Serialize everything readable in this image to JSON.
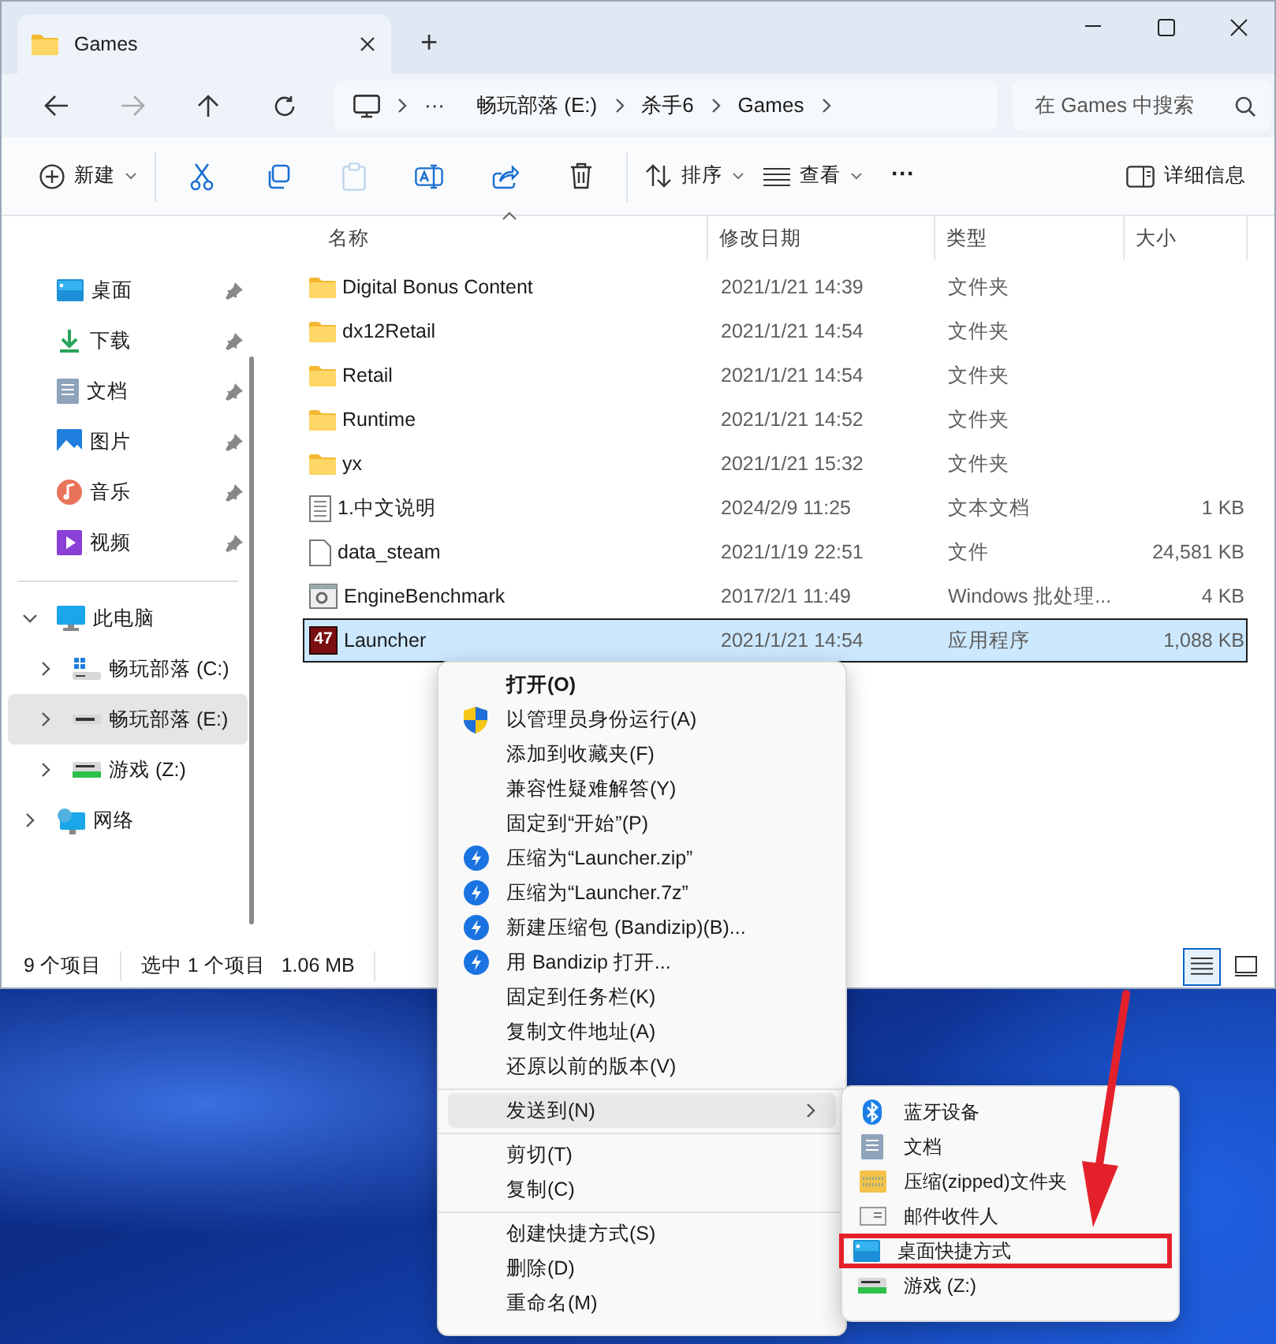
{
  "window": {
    "tab_title": "Games",
    "new_tab": "+"
  },
  "address_bar": {
    "more": "···",
    "breadcrumb": [
      "畅玩部落 (E:)",
      "杀手6",
      "Games"
    ],
    "search_placeholder": "在 Games 中搜索"
  },
  "toolbar": {
    "new_label": "新建",
    "paste_disabled": true,
    "sort_label": "排序",
    "view_label": "查看",
    "more": "···",
    "details_label": "详细信息"
  },
  "sidebar": {
    "quick_access": [
      {
        "label": "桌面",
        "kind": "desktop",
        "pinned": true
      },
      {
        "label": "下载",
        "kind": "downloads",
        "pinned": true
      },
      {
        "label": "文档",
        "kind": "documents",
        "pinned": true
      },
      {
        "label": "图片",
        "kind": "pictures",
        "pinned": true
      },
      {
        "label": "音乐",
        "kind": "music",
        "pinned": true
      },
      {
        "label": "视频",
        "kind": "videos",
        "pinned": true
      }
    ],
    "tree": [
      {
        "label": "此电脑",
        "kind": "pc",
        "expanded": true,
        "selected": false,
        "children": [
          {
            "label": "畅玩部落 (C:)",
            "kind": "system-drive",
            "expanded": false,
            "selected": false
          },
          {
            "label": "畅玩部落 (E:)",
            "kind": "drive",
            "expanded": false,
            "selected": true
          },
          {
            "label": "游戏 (Z:)",
            "kind": "network-drive",
            "expanded": false,
            "selected": false
          }
        ]
      },
      {
        "label": "网络",
        "kind": "network",
        "expanded": false,
        "selected": false
      }
    ]
  },
  "table": {
    "columns": [
      "名称",
      "修改日期",
      "类型",
      "大小"
    ],
    "rows": [
      {
        "name": "Digital Bonus Content",
        "date": "2021/1/21 14:39",
        "type": "文件夹",
        "kind": "folder",
        "selected": false
      },
      {
        "name": "dx12Retail",
        "date": "2021/1/21 14:54",
        "type": "文件夹",
        "kind": "folder",
        "selected": false
      },
      {
        "name": "Retail",
        "date": "2021/1/21 14:54",
        "type": "文件夹",
        "kind": "folder",
        "selected": false
      },
      {
        "name": "Runtime",
        "date": "2021/1/21 14:52",
        "type": "文件夹",
        "kind": "folder",
        "selected": false
      },
      {
        "name": "yx",
        "date": "2021/1/21 15:32",
        "type": "文件夹",
        "kind": "folder",
        "selected": false
      },
      {
        "name": "1.中文说明",
        "date": "2024/2/9 11:25",
        "type": "文本文档",
        "size": "1 KB",
        "kind": "text",
        "selected": false
      },
      {
        "name": "data_steam",
        "date": "2021/1/19 22:51",
        "type": "文件",
        "size": "24,581 KB",
        "kind": "file",
        "selected": false
      },
      {
        "name": "EngineBenchmark",
        "date": "2017/2/1 11:49",
        "type": "Windows 批处理...",
        "size": "4 KB",
        "kind": "batch",
        "selected": false
      },
      {
        "name": "Launcher",
        "date": "2021/1/21 14:54",
        "type": "应用程序",
        "size": "1,088 KB",
        "kind": "app",
        "icon_text": "47",
        "selected": true
      }
    ]
  },
  "status_bar": {
    "item_count": "9 个项目",
    "selection": "选中 1 个项目",
    "selection_size": "1.06 MB",
    "views": [
      {
        "kind": "details",
        "selected": true
      },
      {
        "kind": "tiles",
        "selected": false
      }
    ]
  },
  "context_menu": {
    "items": [
      {
        "kind": "item",
        "label": "打开(O)",
        "default": true,
        "highlighted": false
      },
      {
        "kind": "admin",
        "label": "以管理员身份运行(A)",
        "highlighted": false
      },
      {
        "kind": "item",
        "label": "添加到收藏夹(F)",
        "highlighted": false
      },
      {
        "kind": "item",
        "label": "兼容性疑难解答(Y)",
        "highlighted": false
      },
      {
        "kind": "item",
        "label": "固定到“开始”(P)",
        "highlighted": false
      },
      {
        "kind": "bandizip",
        "label": "压缩为“Launcher.zip”",
        "highlighted": false
      },
      {
        "kind": "bandizip",
        "label": "压缩为“Launcher.7z”",
        "highlighted": false
      },
      {
        "kind": "bandizip",
        "label": "新建压缩包 (Bandizip)(B)...",
        "highlighted": false
      },
      {
        "kind": "bandizip",
        "label": "用 Bandizip 打开...",
        "highlighted": false
      },
      {
        "kind": "item",
        "label": "固定到任务栏(K)",
        "highlighted": false
      },
      {
        "kind": "item",
        "label": "复制文件地址(A)",
        "highlighted": false
      },
      {
        "kind": "item",
        "label": "还原以前的版本(V)",
        "highlighted": false
      },
      {
        "kind": "separator"
      },
      {
        "kind": "submenu",
        "label": "发送到(N)",
        "highlighted": true
      },
      {
        "kind": "separator"
      },
      {
        "kind": "item",
        "label": "剪切(T)",
        "highlighted": false
      },
      {
        "kind": "item",
        "label": "复制(C)",
        "highlighted": false
      },
      {
        "kind": "separator"
      },
      {
        "kind": "item",
        "label": "创建快捷方式(S)",
        "highlighted": false
      },
      {
        "kind": "item",
        "label": "删除(D)",
        "highlighted": false
      },
      {
        "kind": "item",
        "label": "重命名(M)",
        "highlighted": false
      }
    ]
  },
  "send_to_menu": {
    "items": [
      {
        "label": "蓝牙设备",
        "kind": "bluetooth",
        "callout": false
      },
      {
        "label": "文档",
        "kind": "documents",
        "callout": false
      },
      {
        "label": "压缩(zipped)文件夹",
        "kind": "zip",
        "callout": false
      },
      {
        "label": "邮件收件人",
        "kind": "mail",
        "callout": false
      },
      {
        "label": "桌面快捷方式",
        "kind": "desktop",
        "callout": true
      },
      {
        "label": "游戏 (Z:)",
        "kind": "network-drive",
        "callout": false
      }
    ]
  },
  "annotation": {
    "arrow": true
  }
}
